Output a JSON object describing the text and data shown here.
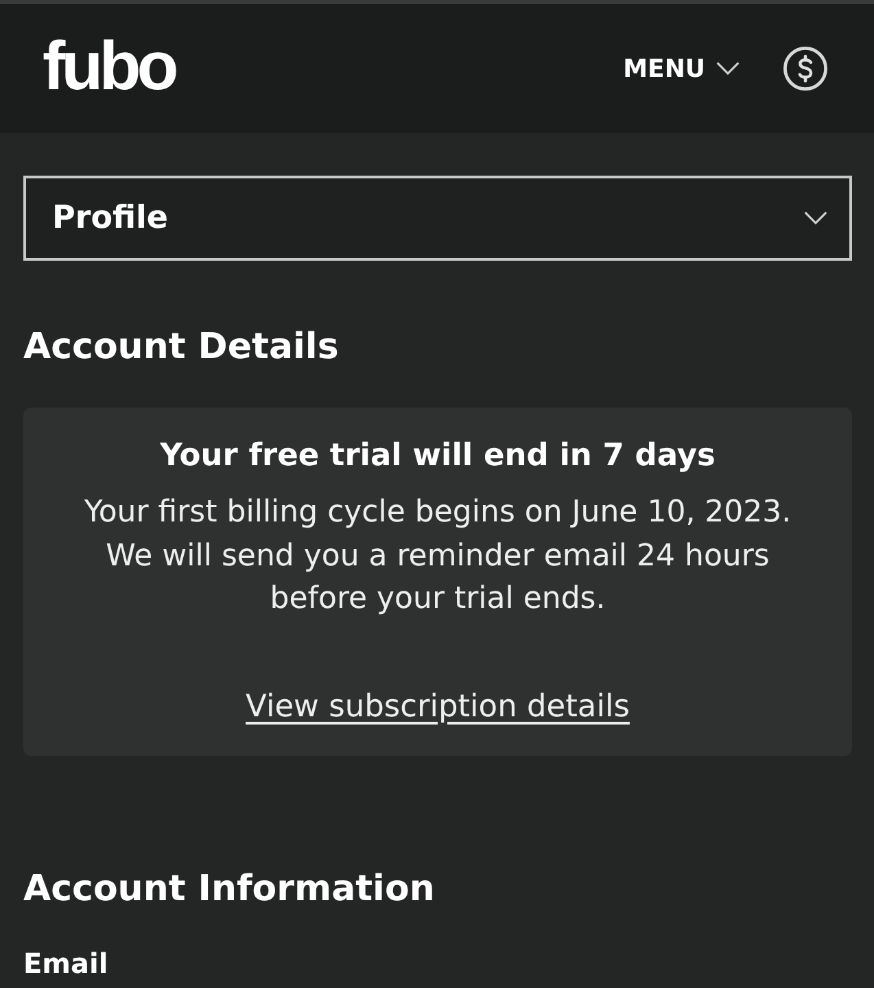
{
  "header": {
    "logo": "fubo",
    "menu_label": "MENU"
  },
  "section_select": {
    "value": "Profile"
  },
  "account_details": {
    "heading": "Account Details",
    "trial_card": {
      "title": "Your free trial will end in 7 days",
      "message": "Your first billing cycle begins on June 10, 2023. We will send you a reminder email 24 hours before your trial ends.",
      "link": "View subscription details"
    }
  },
  "account_information": {
    "heading": "Account Information",
    "fields": [
      {
        "label": "Email"
      }
    ]
  }
}
